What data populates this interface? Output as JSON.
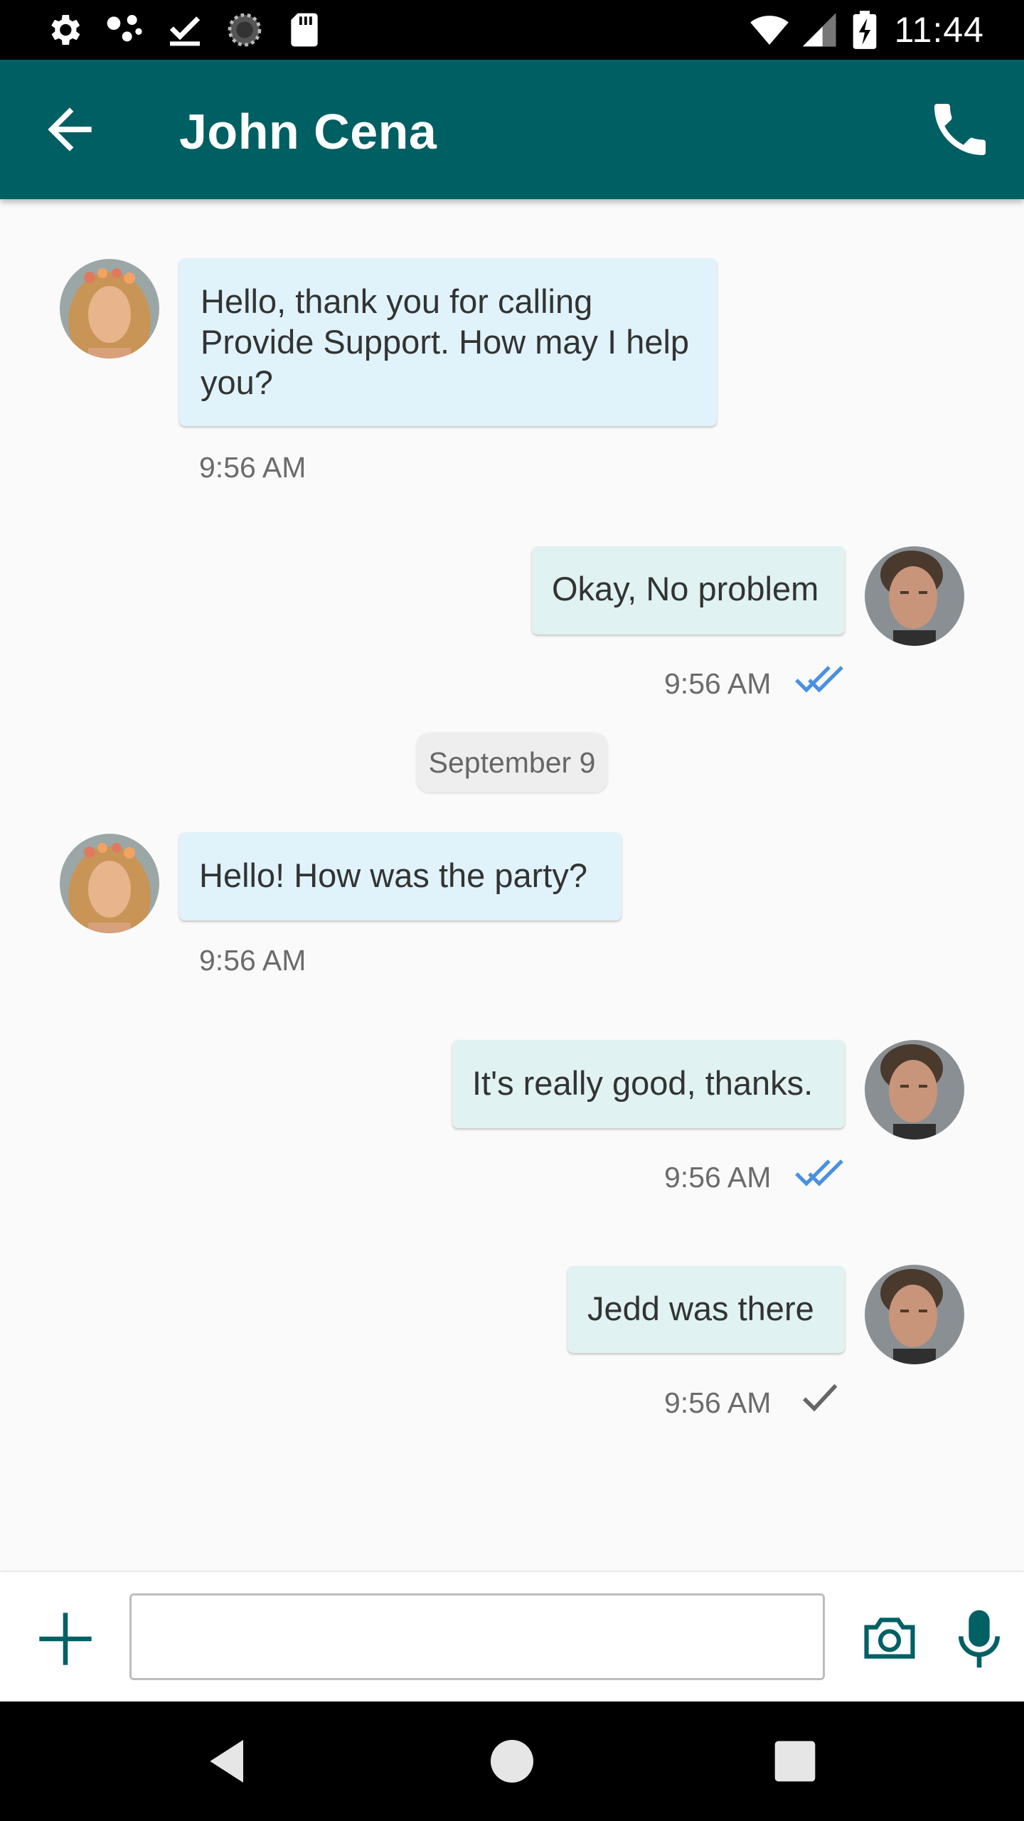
{
  "status_bar": {
    "time": "11:44",
    "left_icons": [
      "settings-icon",
      "dots-icon",
      "download-done-icon",
      "sync-icon",
      "sd-card-icon"
    ],
    "right_icons": [
      "wifi-icon",
      "cell-signal-icon",
      "battery-charging-icon"
    ]
  },
  "header": {
    "title": "John Cena",
    "back_icon": "arrow-back-icon",
    "call_icon": "phone-icon",
    "color": "#005f62"
  },
  "messages": [
    {
      "direction": "incoming",
      "text": "Hello, thank you for calling Provide Support. How may I help you?",
      "time": "9:56 AM"
    },
    {
      "direction": "outgoing",
      "text": "Okay, No problem",
      "time": "9:56 AM",
      "status": "read"
    },
    {
      "direction": "incoming",
      "text": "Hello! How was the party?",
      "time": "9:56 AM"
    },
    {
      "direction": "outgoing",
      "text": "It's really good, thanks.",
      "time": "9:56 AM",
      "status": "read"
    },
    {
      "direction": "outgoing",
      "text": "Jedd was there",
      "time": "9:56 AM",
      "status": "sent"
    }
  ],
  "date_separator": "September 9",
  "composer": {
    "value": "",
    "placeholder": "",
    "icons": [
      "add-icon",
      "camera-icon",
      "microphone-icon"
    ]
  },
  "nav_bar": [
    "back-icon",
    "home-icon",
    "recents-icon"
  ],
  "colors": {
    "incoming_bubble": "#e0f3fb",
    "outgoing_bubble": "#e0f2f1",
    "read_tick": "#4a90e2",
    "sent_tick": "#666666"
  }
}
